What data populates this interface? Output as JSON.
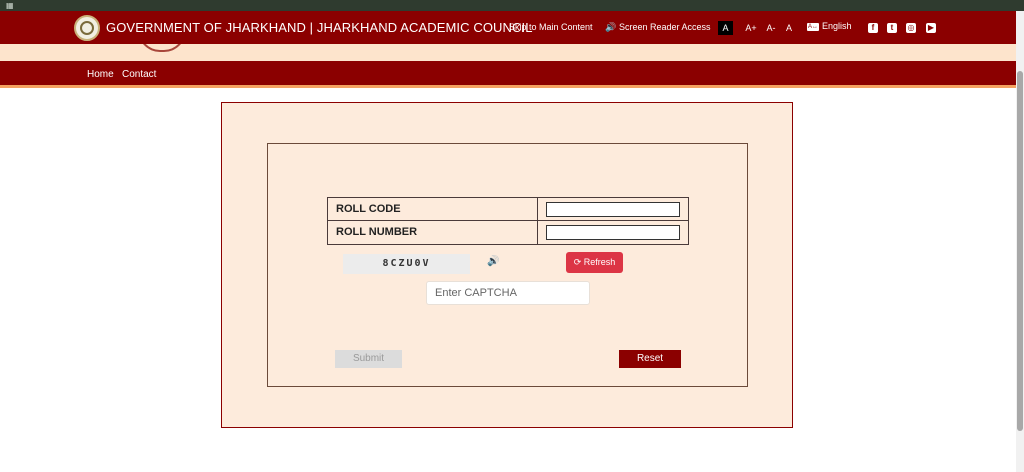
{
  "header": {
    "site_title": "GOVERNMENT OF JHARKHAND | JHARKHAND ACADEMIC COUNCIL",
    "skip_link": "Skip to Main Content",
    "screen_reader": "Screen Reader Access",
    "font_normal": "A",
    "font_increase": "A+",
    "font_decrease": "A-",
    "font_reset": "A",
    "language": "English",
    "language_icon": "language-icon",
    "social": [
      "facebook-icon",
      "twitter-icon",
      "instagram-icon",
      "youtube-icon"
    ]
  },
  "nav": {
    "items": [
      {
        "label": "Home"
      },
      {
        "label": "Contact"
      }
    ]
  },
  "form": {
    "fields": [
      {
        "label": "ROLL CODE",
        "value": ""
      },
      {
        "label": "ROLL NUMBER",
        "value": ""
      }
    ],
    "captcha_text": "8CZU0V",
    "refresh_label": "Refresh",
    "captcha_placeholder": "Enter CAPTCHA",
    "submit_label": "Submit",
    "reset_label": "Reset"
  },
  "colors": {
    "brand": "#8b0000",
    "panel": "#fdebdc",
    "refresh": "#dc3545"
  }
}
